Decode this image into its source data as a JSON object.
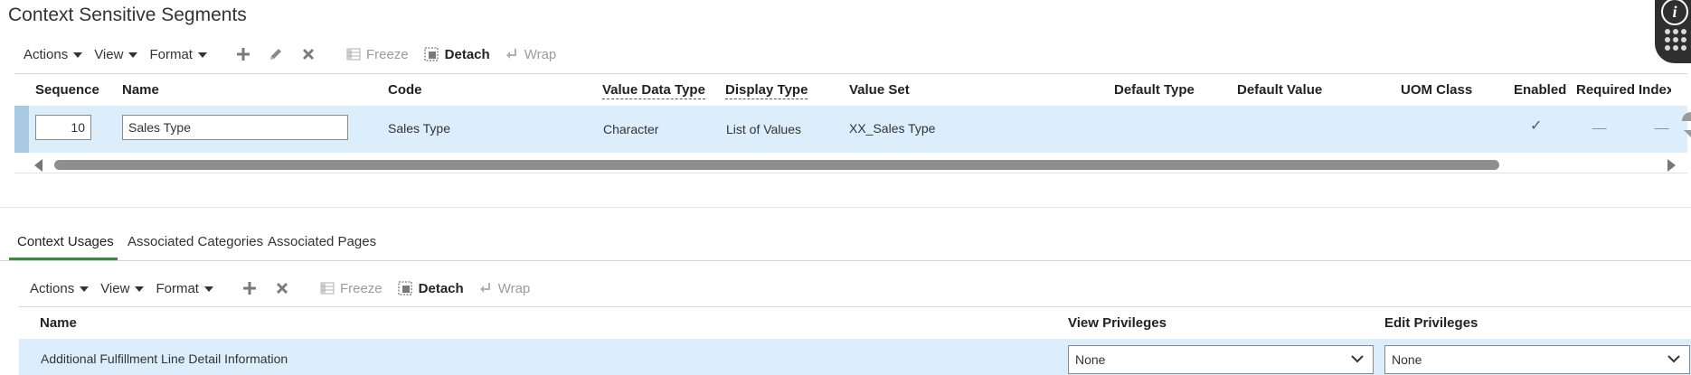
{
  "page": {
    "title": "Context Sensitive Segments"
  },
  "toolbar1": {
    "actions": "Actions",
    "view": "View",
    "format": "Format",
    "freeze": "Freeze",
    "detach": "Detach",
    "wrap": "Wrap"
  },
  "segments_table": {
    "columns": {
      "sequence": "Sequence",
      "name": "Name",
      "code": "Code",
      "value_data_type": "Value Data Type",
      "display_type": "Display Type",
      "value_set": "Value Set",
      "default_type": "Default Type",
      "default_value": "Default Value",
      "uom_class": "UOM Class",
      "enabled": "Enabled",
      "required": "Required",
      "indexed": "Indexed"
    },
    "rows": [
      {
        "sequence": "10",
        "name": "Sales Type",
        "code": "Sales Type",
        "value_data_type": "Character",
        "display_type": "List of Values",
        "value_set": "XX_Sales Type",
        "enabled_mark": "✓",
        "required_mark": "__",
        "indexed_mark": "__"
      }
    ]
  },
  "tabs": [
    {
      "label": "Context Usages",
      "active": true
    },
    {
      "label": "Associated Categories",
      "active": false
    },
    {
      "label": "Associated Pages",
      "active": false
    }
  ],
  "toolbar2": {
    "actions": "Actions",
    "view": "View",
    "format": "Format",
    "freeze": "Freeze",
    "detach": "Detach",
    "wrap": "Wrap"
  },
  "usages_table": {
    "columns": {
      "name": "Name",
      "view_privileges": "View Privileges",
      "edit_privileges": "Edit Privileges"
    },
    "rows": [
      {
        "name": "Additional Fulfillment Line Detail Information",
        "view_privileges": "None",
        "edit_privileges": "None"
      }
    ]
  },
  "help_badge": {
    "info_glyph": "i"
  },
  "colors": {
    "selected_row": "#dceefb",
    "active_tab": "#3b8a3e",
    "badge": "#2f2f2f"
  }
}
